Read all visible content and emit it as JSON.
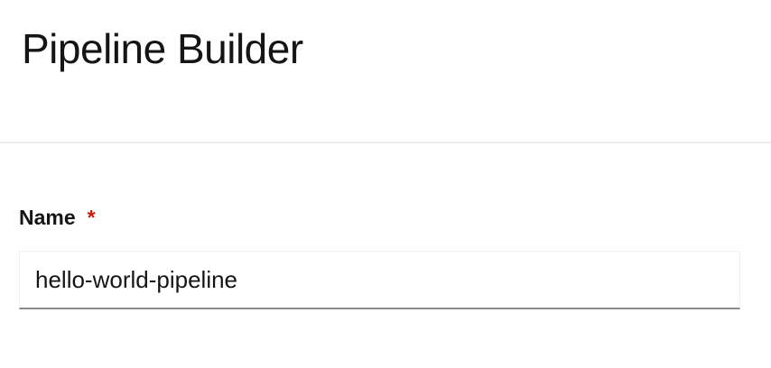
{
  "header": {
    "title": "Pipeline Builder"
  },
  "form": {
    "name_label": "Name",
    "required_marker": "*",
    "name_value": "hello-world-pipeline",
    "required_color": "#c9190b"
  }
}
